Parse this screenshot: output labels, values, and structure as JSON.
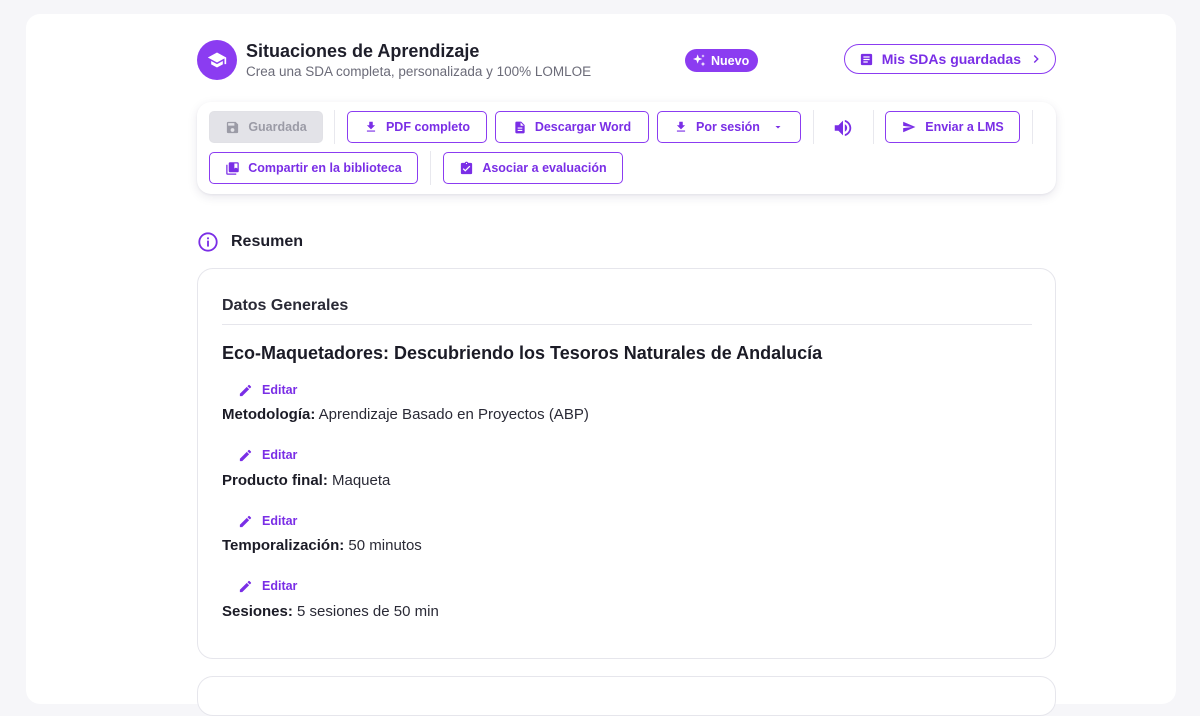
{
  "header": {
    "title": "Situaciones de Aprendizaje",
    "subtitle": "Crea una SDA completa, personalizada y 100% LOMLOE",
    "badge": "Nuevo",
    "saved_button": "Mis SDAs guardadas",
    "logo_icon": "graduation-cap-icon"
  },
  "toolbar": {
    "saved_label": "Guardada",
    "pdf_label": "PDF completo",
    "word_label": "Descargar Word",
    "session_label": "Por sesión",
    "lms_label": "Enviar a LMS",
    "share_label": "Compartir en la biblioteca",
    "evaluation_label": "Asociar a evaluación"
  },
  "summary": {
    "heading": "Resumen",
    "card_title": "Datos Generales",
    "sda_title": "Eco-Maquetadores: Descubriendo los Tesoros Naturales de Andalucía",
    "edit_label": "Editar",
    "fields": [
      {
        "label": "Metodología:",
        "value": "Aprendizaje Basado en Proyectos (ABP)"
      },
      {
        "label": "Producto final:",
        "value": "Maqueta"
      },
      {
        "label": "Temporalización:",
        "value": "50 minutos"
      },
      {
        "label": "Sesiones:",
        "value": "5 sesiones de 50 min"
      }
    ]
  },
  "colors": {
    "accent": "#8b3cf1",
    "accent_text": "#7a2ee6",
    "disabled_bg": "#e3e3e8",
    "border": "#e6e6ec"
  }
}
